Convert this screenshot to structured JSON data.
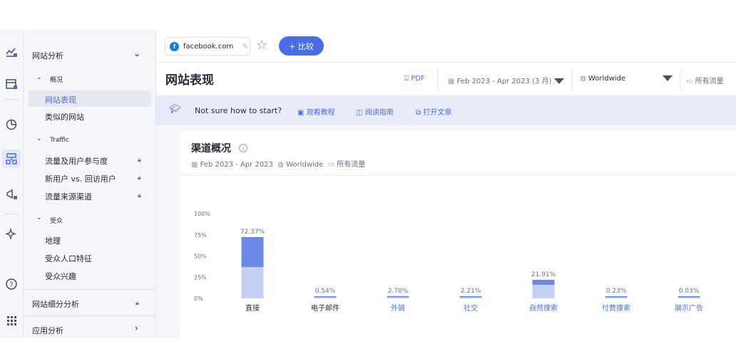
{
  "topbar": {
    "site_name": "facebook.com",
    "site_icon_letter": "f",
    "compare_label": "+ 比较"
  },
  "header": {
    "title": "网站表现",
    "pdf_label": "PDF",
    "date_range": "Feb 2023 - Apr 2023 (3 月)",
    "region": "Worldwide",
    "traffic": "所有流量"
  },
  "help": {
    "prompt": "Not sure how to start?",
    "links": [
      "观看教程",
      "阅读指南",
      "打开文章"
    ]
  },
  "sidebar": {
    "section_title": "网站分析",
    "groups": [
      {
        "label": "概况",
        "items": [
          {
            "label": "网站表现",
            "active": true
          },
          {
            "label": "类似的网站"
          }
        ]
      },
      {
        "label": "Traffic",
        "items": [
          {
            "label": "流量及用户参与度",
            "locked": true
          },
          {
            "label": "新用户 vs. 回访用户",
            "locked": true
          },
          {
            "label": "流量来源渠道",
            "locked": true
          }
        ]
      },
      {
        "label": "受众",
        "items": [
          {
            "label": "地理"
          },
          {
            "label": "受众人口特征"
          },
          {
            "label": "受众兴趣"
          }
        ]
      }
    ],
    "bottom_items": [
      {
        "label": "网站细分分析",
        "locked": true
      },
      {
        "label": "应用分析"
      }
    ]
  },
  "card": {
    "title": "渠道概况",
    "date": "Feb 2023 - Apr 2023",
    "region": "Worldwide",
    "traffic": "所有流量"
  },
  "colors": {
    "accent": "#4a6de5",
    "bar_dark": "#6b8ae8",
    "bar_light": "#c3d0f5",
    "link_label": "#4a6de5",
    "plain_label": "#2a2a3c"
  },
  "chart_data": {
    "type": "bar",
    "stacked": true,
    "ylim": [
      0,
      100
    ],
    "yticks": [
      "100%",
      "75%",
      "50%",
      "25%",
      "0%"
    ],
    "grid": false,
    "categories": [
      "直接",
      "电子邮件",
      "外链",
      "社交",
      "自然搜索",
      "付费搜索",
      "展示广告"
    ],
    "value_labels": [
      "72.37%",
      "0.54%",
      "2.70%",
      "2.21%",
      "21.91%",
      "0.23%",
      "0.03%"
    ],
    "totals": [
      72.37,
      0.54,
      2.7,
      2.21,
      21.91,
      0.23,
      0.03
    ],
    "light_part": [
      37,
      0.3,
      1.3,
      1.1,
      16,
      0.1,
      0.01
    ],
    "dark_part": [
      35.37,
      0.24,
      1.4,
      1.11,
      5.91,
      0.13,
      0.02
    ],
    "category_is_link": [
      false,
      false,
      true,
      true,
      true,
      true,
      true
    ]
  }
}
